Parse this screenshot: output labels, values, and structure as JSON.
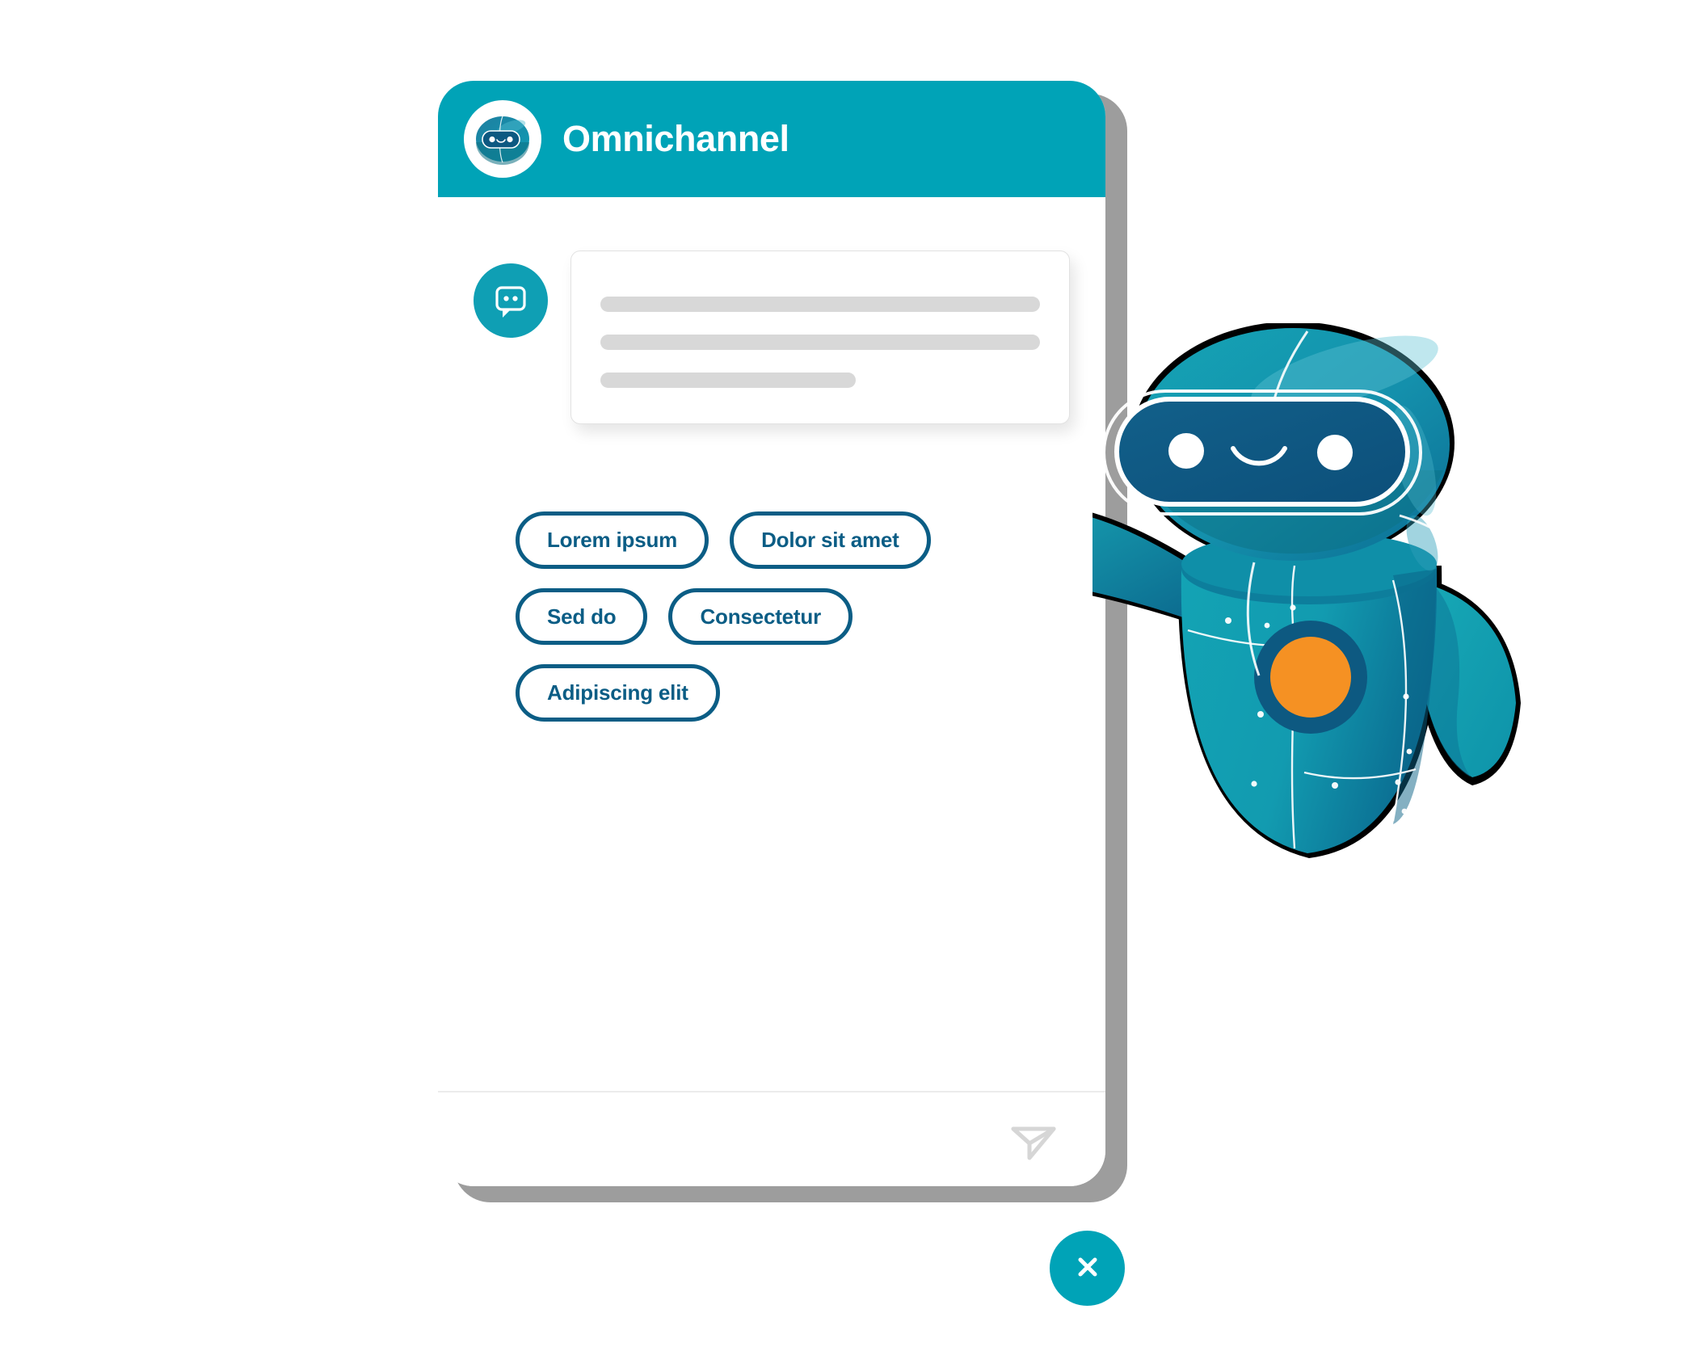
{
  "header": {
    "title": "Omnichannel",
    "avatar_icon": "robot-head-icon"
  },
  "message": {
    "avatar_icon": "chat-bot-bubble-icon",
    "skeleton_lines": [
      {
        "width": "100%"
      },
      {
        "width": "100%"
      },
      {
        "width": "58%"
      }
    ]
  },
  "quick_replies": [
    {
      "label": "Lorem ipsum"
    },
    {
      "label": "Dolor sit amet"
    },
    {
      "label": "Sed do"
    },
    {
      "label": "Consectetur"
    },
    {
      "label": "Adipiscing elit"
    }
  ],
  "composer": {
    "send_icon": "send-paper-plane-icon"
  },
  "close": {
    "icon": "close-x-icon"
  },
  "mascot": {
    "name": "robot-mascot",
    "description": "teal robot with visor face, smile, and orange chest button"
  },
  "colors": {
    "teal": "#00a3b7",
    "teal_avatar": "#0f9fb4",
    "button_border": "#0b5d85",
    "skeleton": "#d8d8d8",
    "send_icon": "#d6d6d6",
    "frame_shadow": "#9d9d9d",
    "mascot_dark_blue": "#0d5981",
    "mascot_teal": "#0f9cb4",
    "mascot_orange": "#f59123",
    "page_background": "#ffffff"
  }
}
